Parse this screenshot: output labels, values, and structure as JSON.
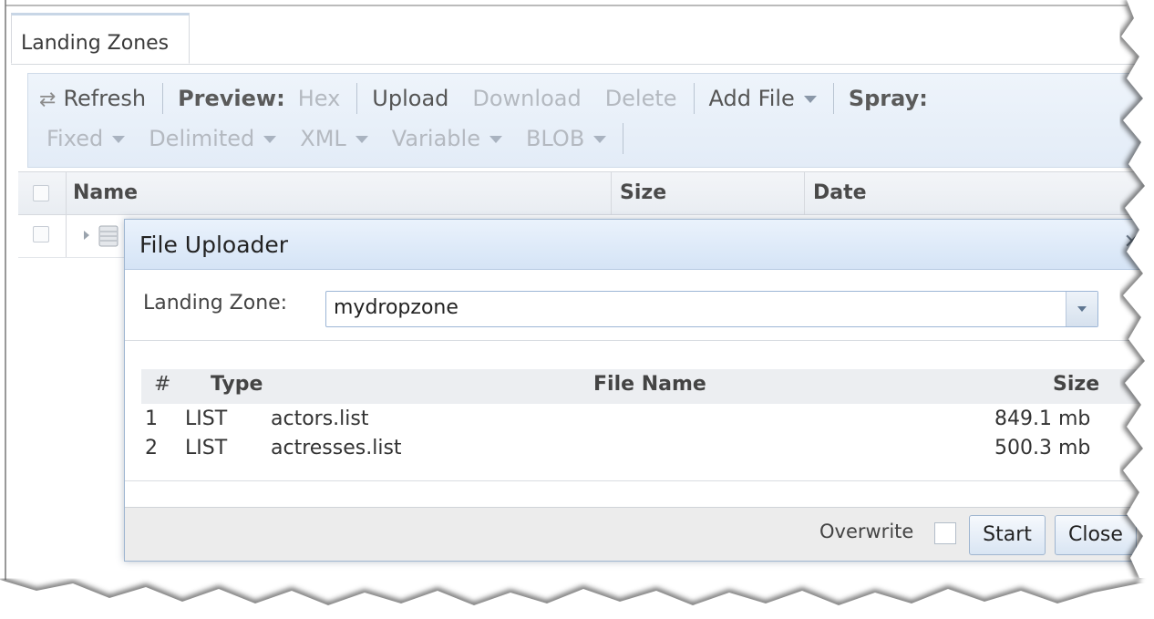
{
  "tabs": [
    {
      "label": "Landing Zones"
    }
  ],
  "toolbar": {
    "refresh": "Refresh",
    "preview_label": "Preview:",
    "hex": "Hex",
    "upload": "Upload",
    "download": "Download",
    "delete": "Delete",
    "add_file": "Add File",
    "spray_label": "Spray:",
    "fixed": "Fixed",
    "delimited": "Delimited",
    "xml": "XML",
    "variable": "Variable",
    "blob": "BLOB"
  },
  "grid": {
    "columns": [
      "Name",
      "Size",
      "Date"
    ]
  },
  "dialog": {
    "title": "File Uploader",
    "landing_zone_label": "Landing Zone:",
    "landing_zone_value": "mydropzone",
    "table": {
      "headers": [
        "#",
        "Type",
        "File Name",
        "Size"
      ],
      "rows": [
        {
          "num": "1",
          "type": "LIST",
          "name": "actors.list",
          "size": "849.1 mb"
        },
        {
          "num": "2",
          "type": "LIST",
          "name": "actresses.list",
          "size": "500.3 mb"
        }
      ]
    },
    "overwrite_label": "Overwrite",
    "start": "Start",
    "close": "Close"
  },
  "colors": {
    "toolbar_bg": "#e8f0f9",
    "dialog_title_bg": "#dde9f7",
    "disabled_text": "#b4b9c0"
  },
  "icons": {
    "refresh": "refresh-icon",
    "expander": "expander-arrow-icon",
    "database": "database-icon",
    "dropdown": "chevron-down-icon"
  }
}
